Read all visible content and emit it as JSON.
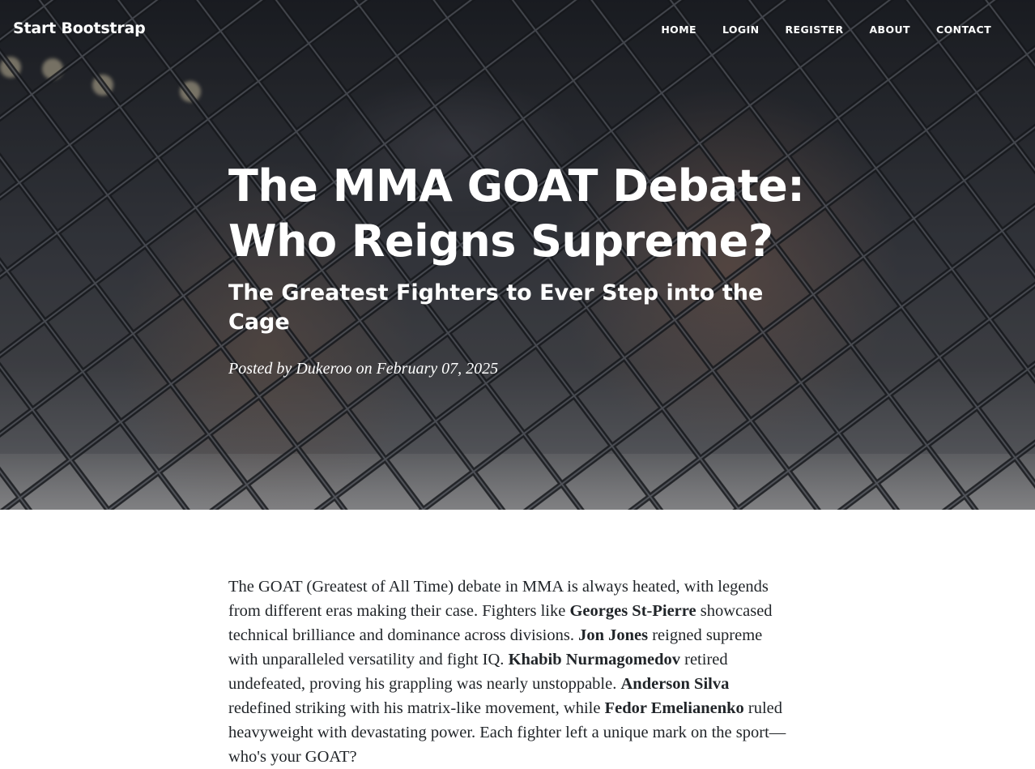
{
  "navbar": {
    "brand": "Start Bootstrap",
    "links": [
      "HOME",
      "LOGIN",
      "REGISTER",
      "ABOUT",
      "CONTACT"
    ]
  },
  "header": {
    "title_line1": "The MMA GOAT Debate:",
    "title_line2": "Who Reigns Supreme?",
    "subtitle": "The Greatest Fighters to Ever Step into the Cage",
    "meta_prefix": "Posted by",
    "author": "Dukeroo",
    "meta_on": "on",
    "date": "February 07, 2025"
  },
  "post": {
    "segments": [
      {
        "text": "The GOAT (Greatest of All Time) debate in MMA is always heated, with legends from different eras making their case. Fighters like ",
        "bold": false
      },
      {
        "text": "Georges St-Pierre",
        "bold": true
      },
      {
        "text": " showcased technical brilliance and dominance across divisions. ",
        "bold": false
      },
      {
        "text": "Jon Jones",
        "bold": true
      },
      {
        "text": " reigned supreme with unparalleled versatility and fight IQ. ",
        "bold": false
      },
      {
        "text": "Khabib Nurmagomedov",
        "bold": true
      },
      {
        "text": " retired undefeated, proving his grappling was nearly unstoppable. ",
        "bold": false
      },
      {
        "text": "Anderson Silva",
        "bold": true
      },
      {
        "text": " redefined striking with his matrix-like movement, while ",
        "bold": false
      },
      {
        "text": "Fedor Emelianenko",
        "bold": true
      },
      {
        "text": " ruled heavyweight with devastating power. Each fighter left a unique mark on the sport—who's your GOAT?",
        "bold": false
      }
    ]
  }
}
